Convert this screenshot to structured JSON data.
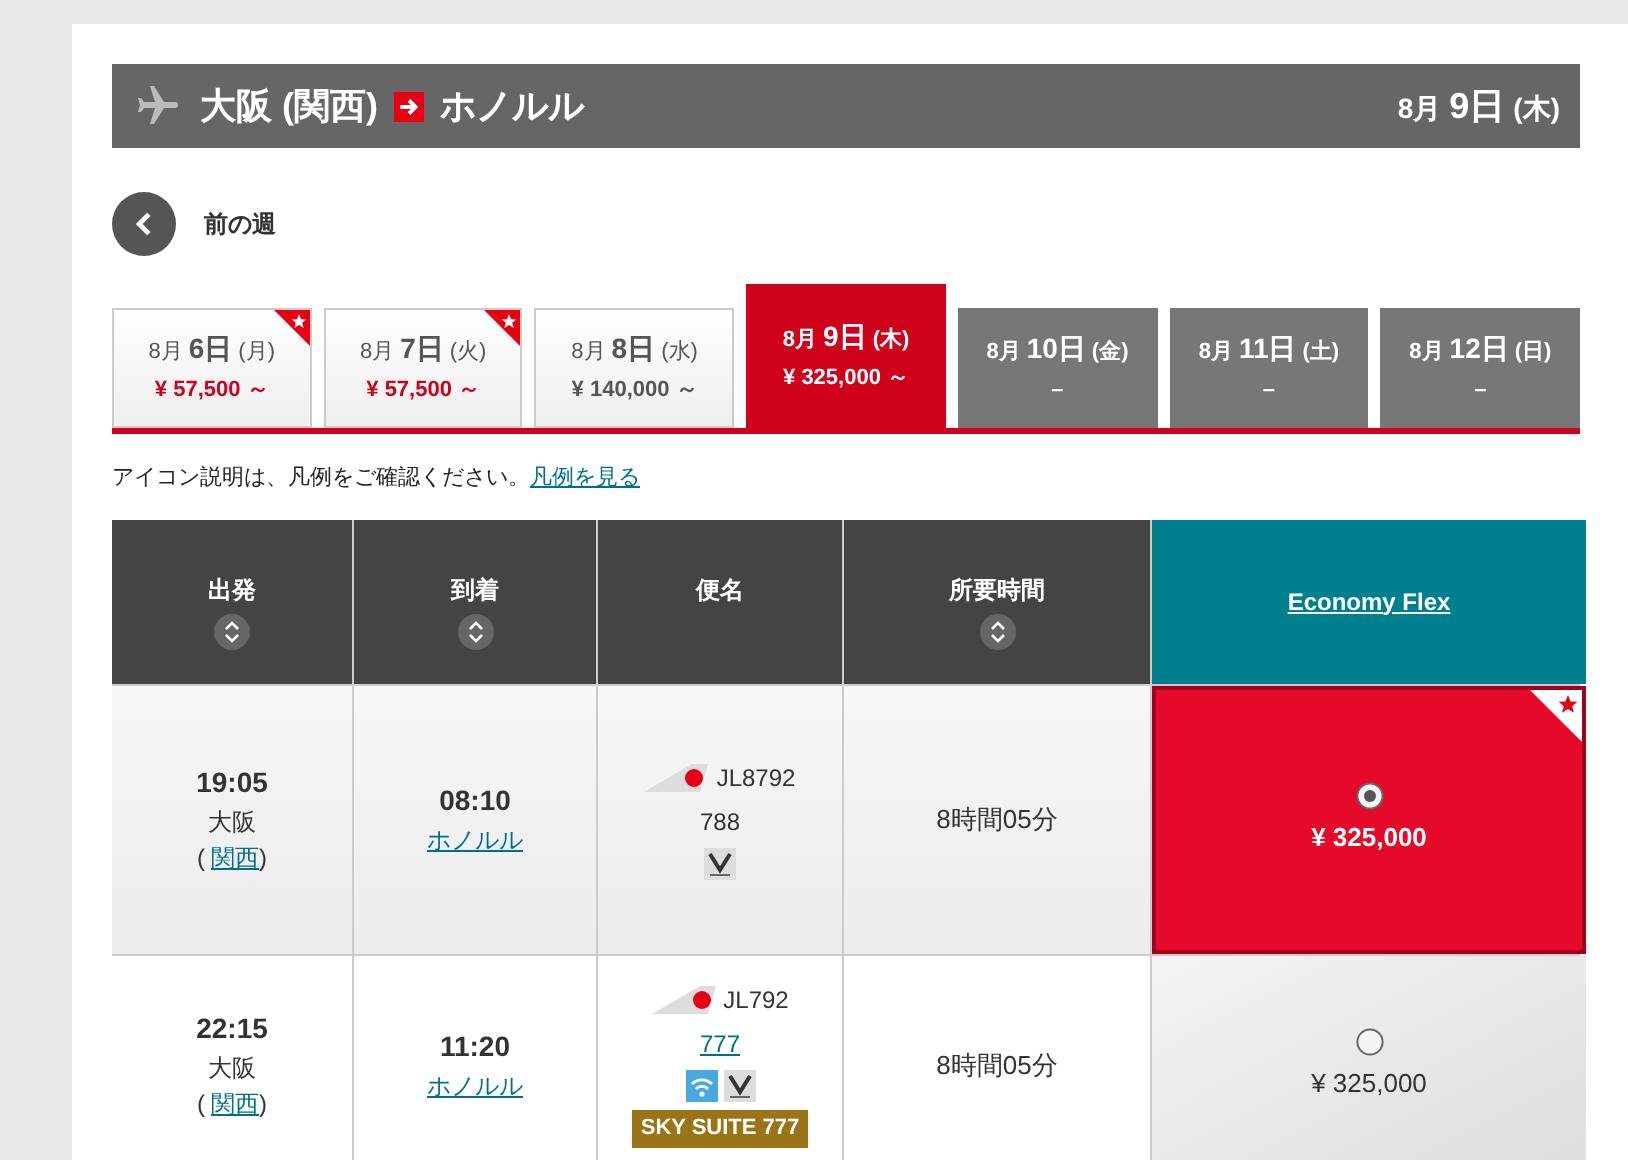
{
  "route": {
    "origin": "大阪 (関西)",
    "destination": "ホノルル",
    "month": "8月",
    "day": "9日",
    "weekday": "(木)"
  },
  "prev_week": {
    "label": "前の週"
  },
  "date_tabs": [
    {
      "month": "8月",
      "day": "6日",
      "weekday": "(月)",
      "price": "¥ 57,500 ～",
      "star": true,
      "selected": false,
      "available": true
    },
    {
      "month": "8月",
      "day": "7日",
      "weekday": "(火)",
      "price": "¥ 57,500 ～",
      "star": true,
      "selected": false,
      "available": true
    },
    {
      "month": "8月",
      "day": "8日",
      "weekday": "(水)",
      "price": "¥ 140,000 ～",
      "star": false,
      "selected": false,
      "available": true
    },
    {
      "month": "8月",
      "day": "9日",
      "weekday": "(木)",
      "price": "¥ 325,000 ～",
      "star": false,
      "selected": true,
      "available": true
    },
    {
      "month": "8月",
      "day": "10日",
      "weekday": "(金)",
      "price": "–",
      "star": false,
      "selected": false,
      "available": false
    },
    {
      "month": "8月",
      "day": "11日",
      "weekday": "(土)",
      "price": "–",
      "star": false,
      "selected": false,
      "available": false
    },
    {
      "month": "8月",
      "day": "12日",
      "weekday": "(日)",
      "price": "–",
      "star": false,
      "selected": false,
      "available": false
    }
  ],
  "legend": {
    "text": "アイコン説明は、凡例をご確認ください。",
    "link": "凡例を見る"
  },
  "table": {
    "columns": [
      {
        "label": "出発",
        "sortable": true
      },
      {
        "label": "到着",
        "sortable": true
      },
      {
        "label": "便名",
        "sortable": false
      },
      {
        "label": "所要時間",
        "sortable": true
      }
    ],
    "fare_column": "Economy Flex",
    "rows": [
      {
        "depart_time": "19:05",
        "depart_city": "大阪",
        "paren_open": "(",
        "depart_airport": "関西",
        "paren_close": ")",
        "arrive_time": "08:10",
        "arrive_city": "ホノルル",
        "flight": "JL8792",
        "aircraft": "788",
        "aircraft_link": false,
        "amenities": [
          {
            "kind": "magic"
          }
        ],
        "badge": null,
        "duration": "8時間05分",
        "fare": {
          "price": "¥ 325,000",
          "selected": true,
          "star": true
        }
      },
      {
        "depart_time": "22:15",
        "depart_city": "大阪",
        "paren_open": "(",
        "depart_airport": "関西",
        "paren_close": ")",
        "arrive_time": "11:20",
        "arrive_city": "ホノルル",
        "flight": "JL792",
        "aircraft": "777",
        "aircraft_link": true,
        "amenities": [
          {
            "kind": "wifi"
          },
          {
            "kind": "magic"
          }
        ],
        "badge": "SKY SUITE 777",
        "duration": "8時間05分",
        "fare": {
          "price": "¥ 325,000",
          "selected": false,
          "star": false
        }
      }
    ]
  }
}
